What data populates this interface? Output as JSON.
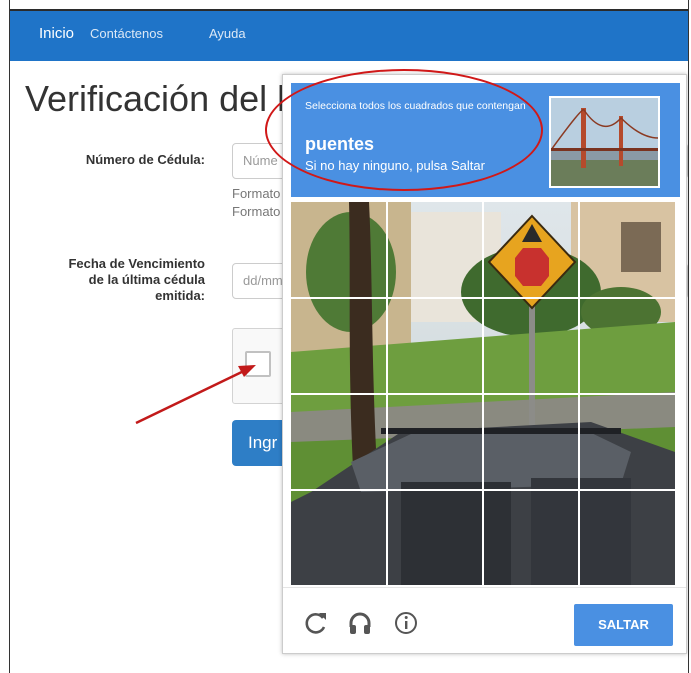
{
  "nav": {
    "items": [
      {
        "label": "Inicio"
      },
      {
        "label": "Contáctenos"
      },
      {
        "label": "Ayuda"
      }
    ]
  },
  "page": {
    "title": "Verificación del l",
    "cedula_label": "Número de Cédula:",
    "cedula_placeholder": "Núme",
    "cedula_help_1": "Formato",
    "cedula_help_2": "Formato",
    "fecha_label_1": "Fecha de Vencimiento",
    "fecha_label_2": "de la última cédula",
    "fecha_label_3": "emitida:",
    "fecha_placeholder": "dd/mm",
    "submit_label": "Ingr"
  },
  "challenge": {
    "instruction": "Selecciona todos los cuadrados que contengan",
    "keyword": "puentes",
    "skip_hint": "Si no hay ninguno, pulsa Saltar",
    "skip_button": "SALTAR",
    "icons": [
      "reload-icon",
      "audio-icon",
      "info-icon"
    ]
  },
  "colors": {
    "navbar": "#1f74c8",
    "challenge_header": "#4a90e2",
    "annotation": "#d01818"
  }
}
